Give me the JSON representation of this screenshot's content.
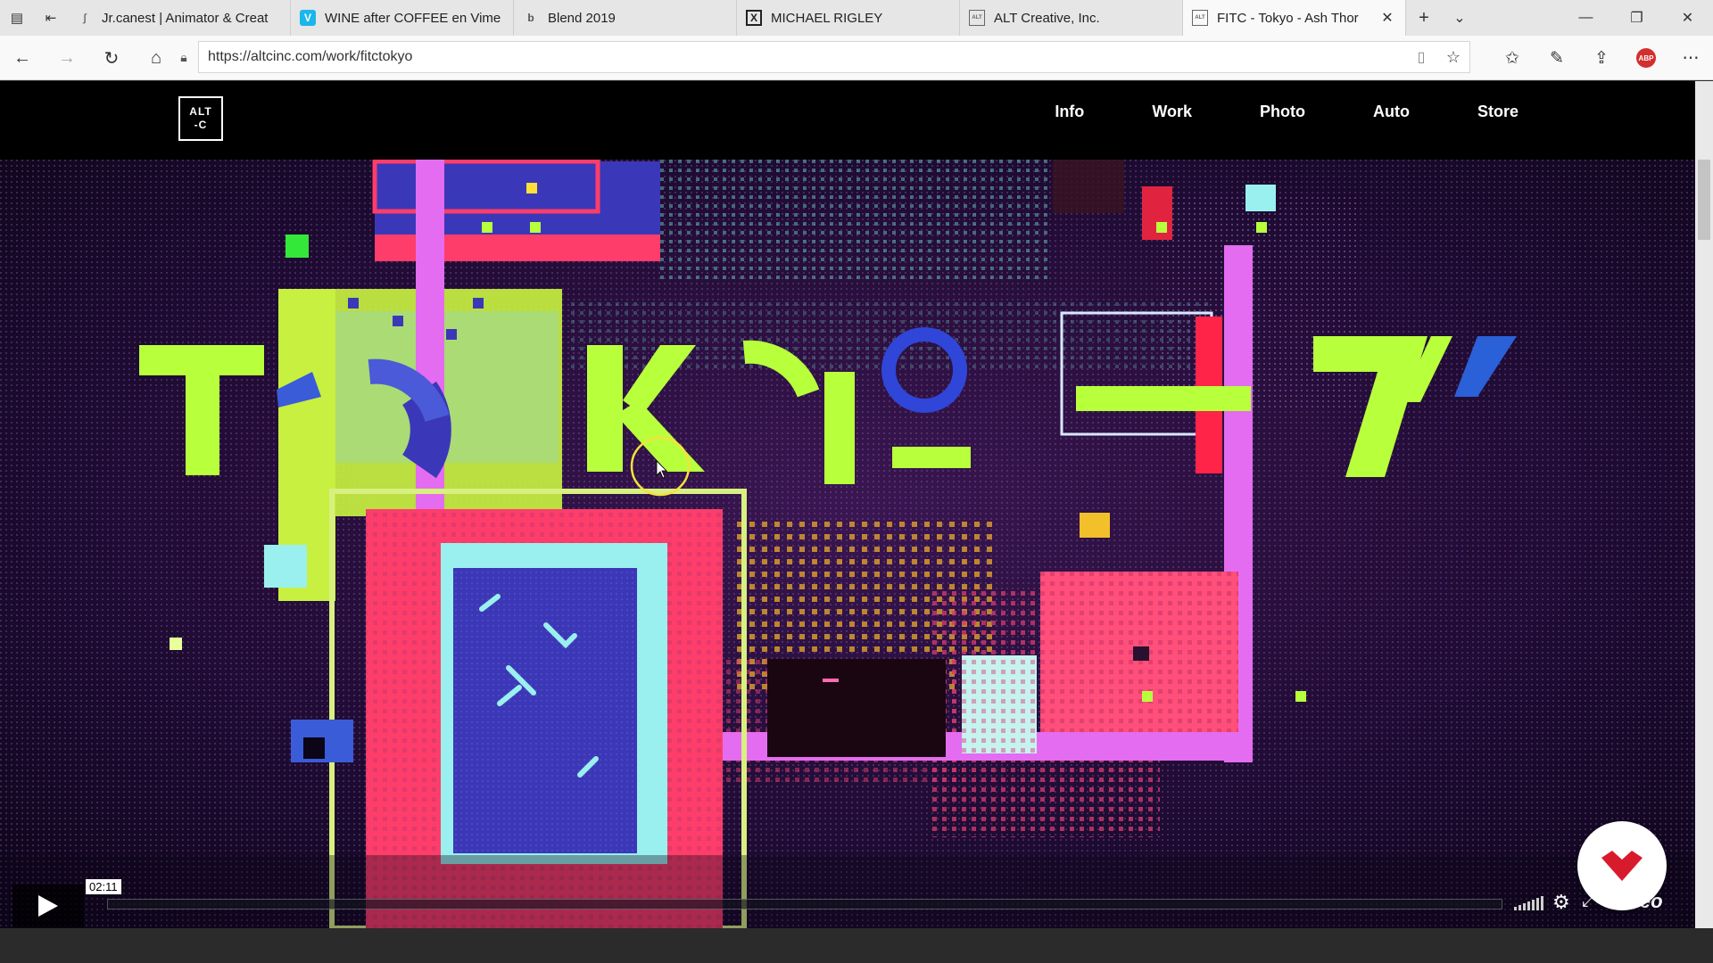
{
  "browser": {
    "tabs": [
      {
        "title": "Jr.canest | Animator & Creat",
        "favicon": "J"
      },
      {
        "title": "WINE after COFFEE en Vime",
        "favicon": "V"
      },
      {
        "title": "Blend 2019",
        "favicon": "b"
      },
      {
        "title": "MICHAEL RIGLEY",
        "favicon": "X"
      },
      {
        "title": "ALT Creative, Inc.",
        "favicon": "ALT"
      },
      {
        "title": "FITC - Tokyo - Ash Thor",
        "favicon": "ALT",
        "active": true
      }
    ],
    "url": "https://altcinc.com/work/fitctokyo"
  },
  "site": {
    "logo": {
      "line1": "ALT",
      "line2": "-C"
    },
    "menu": [
      "Info",
      "Work",
      "Photo",
      "Auto",
      "Store"
    ]
  },
  "video": {
    "time": "02:11",
    "brand": "vimeo",
    "colors": {
      "lime": "#b8ff3c",
      "magenta": "#e46cf0",
      "red": "#ff3d6a",
      "cyan": "#9af0ee",
      "blue": "#3a38b8",
      "bg": "#1a0a2a"
    }
  }
}
